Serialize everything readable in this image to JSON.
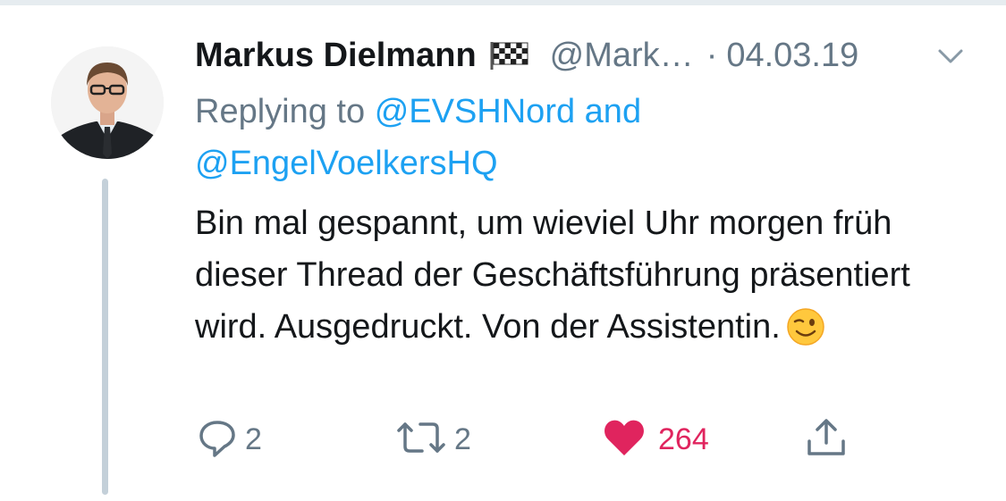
{
  "tweet": {
    "author_name": "Markus Dielmann",
    "author_flag": "checkered-flag-emoji",
    "handle": "@Mark…",
    "separator": "·",
    "date": "04.03.19",
    "reply_prefix": "Replying to",
    "reply_mention_1": "@EVSHNord",
    "reply_and": "and",
    "reply_mention_2": "@EngelVoelkersHQ",
    "text": "Bin mal gespannt, um wieviel Uhr morgen früh dieser Thread der Geschäftsführung präsentiert wird. Ausgedruckt. Von der Assistentin.",
    "emoji": "winking-face-emoji"
  },
  "actions": {
    "reply_count": "2",
    "retweet_count": "2",
    "like_count": "264",
    "liked": true
  },
  "colors": {
    "text": "#14171a",
    "secondary": "#657786",
    "link": "#1da1f2",
    "like": "#e0245e",
    "thread_line": "#c4d0d9"
  },
  "icons": [
    "chevron-down-icon",
    "reply-icon",
    "retweet-icon",
    "heart-icon",
    "share-icon"
  ]
}
